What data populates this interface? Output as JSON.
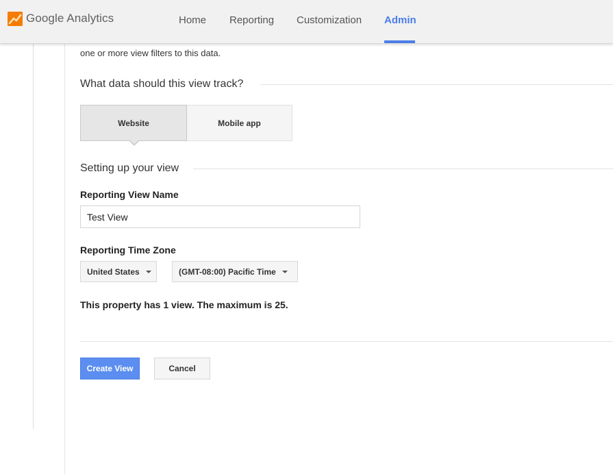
{
  "header": {
    "brand": "Google Analytics",
    "nav": [
      {
        "label": "Home"
      },
      {
        "label": "Reporting"
      },
      {
        "label": "Customization"
      },
      {
        "label": "Admin"
      }
    ],
    "active_nav": "Admin",
    "colors": {
      "accent": "#4a7de8",
      "logo_orange": "#f57c00",
      "logo_yellow": "#ffb300"
    }
  },
  "content": {
    "clipped_text": "one or more view filters to this data.",
    "track_section": {
      "title": "What data should this view track?",
      "options": [
        {
          "label": "Website",
          "selected": true
        },
        {
          "label": "Mobile app",
          "selected": false
        }
      ]
    },
    "setup_section": {
      "title": "Setting up your view"
    },
    "view_name": {
      "label": "Reporting View Name",
      "value": "Test View"
    },
    "time_zone": {
      "label": "Reporting Time Zone",
      "country": "United States",
      "zone": "(GMT-08:00) Pacific Time"
    },
    "notice": "This property has 1 view. The maximum is 25.",
    "buttons": {
      "create": "Create View",
      "cancel": "Cancel"
    },
    "colors": {
      "primary_button": "#5b8ef0"
    }
  }
}
